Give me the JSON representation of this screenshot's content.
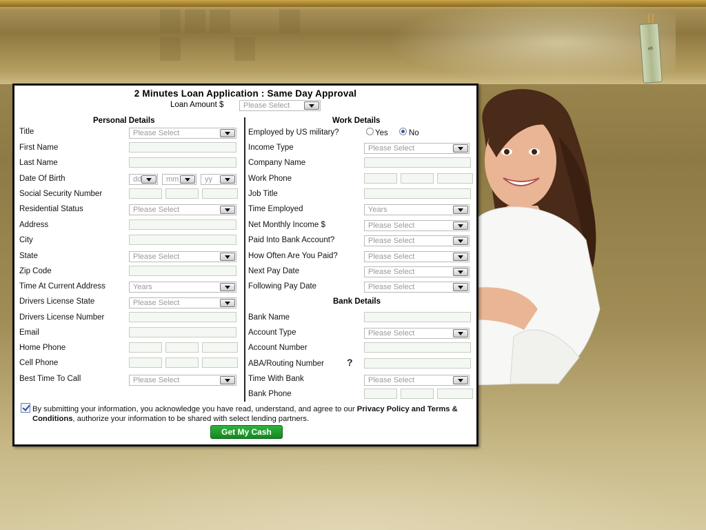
{
  "form": {
    "title": "2 Minutes Loan Application : Same Day Approval",
    "loan_amount_label": "Loan Amount $",
    "loan_amount_value": "Please Select"
  },
  "personal": {
    "heading": "Personal Details",
    "title_label": "Title",
    "title_value": "Please Select",
    "first_name_label": "First Name",
    "last_name_label": "Last Name",
    "dob_label": "Date Of Birth",
    "dob_dd": "dd",
    "dob_mm": "mm",
    "dob_yy": "yy",
    "ssn_label": "Social Security Number",
    "residential_label": "Residential Status",
    "residential_value": "Please Select",
    "address_label": "Address",
    "city_label": "City",
    "state_label": "State",
    "state_value": "Please Select",
    "zip_label": "Zip Code",
    "time_address_label": "Time At Current Address",
    "time_address_value": "Years",
    "dl_state_label": "Drivers License State",
    "dl_state_value": "Please Select",
    "dl_number_label": "Drivers License Number",
    "email_label": "Email",
    "home_phone_label": "Home Phone",
    "cell_phone_label": "Cell Phone",
    "best_time_label": "Best Time To Call",
    "best_time_value": "Please Select"
  },
  "work": {
    "heading": "Work Details",
    "military_label": "Employed by US military?",
    "military_yes": "Yes",
    "military_no": "No",
    "income_type_label": "Income Type",
    "income_type_value": "Please Select",
    "company_label": "Company Name",
    "work_phone_label": "Work Phone",
    "job_title_label": "Job Title",
    "time_employed_label": "Time Employed",
    "time_employed_value": "Years",
    "net_income_label": "Net Monthly Income $",
    "net_income_value": "Please Select",
    "bank_paid_label": "Paid Into Bank Account?",
    "bank_paid_value": "Please Select",
    "how_often_label": "How Often Are You Paid?",
    "how_often_value": "Please Select",
    "next_pay_label": "Next Pay Date",
    "next_pay_value": "Please Select",
    "following_pay_label": "Following Pay Date",
    "following_pay_value": "Please Select"
  },
  "bank": {
    "heading": "Bank Details",
    "bank_name_label": "Bank Name",
    "account_type_label": "Account Type",
    "account_type_value": "Please Select",
    "account_number_label": "Account Number",
    "aba_label": "ABA/Routing Number",
    "aba_help": "?",
    "time_bank_label": "Time With Bank",
    "time_bank_value": "Please Select",
    "bank_phone_label": "Bank Phone"
  },
  "consent": {
    "text_1": "By submitting your information, you acknowledge you have read, understand, and agree to our ",
    "privacy_link": "Privacy Policy and Terms & Conditions",
    "text_2": ", authorize your information to be shared with select lending partners.",
    "checked": true
  },
  "submit_label": "Get My Cash",
  "decor": {
    "bill_text": "$",
    "accent_green": "#1f9a2d",
    "background_gold": "#a08c55"
  }
}
